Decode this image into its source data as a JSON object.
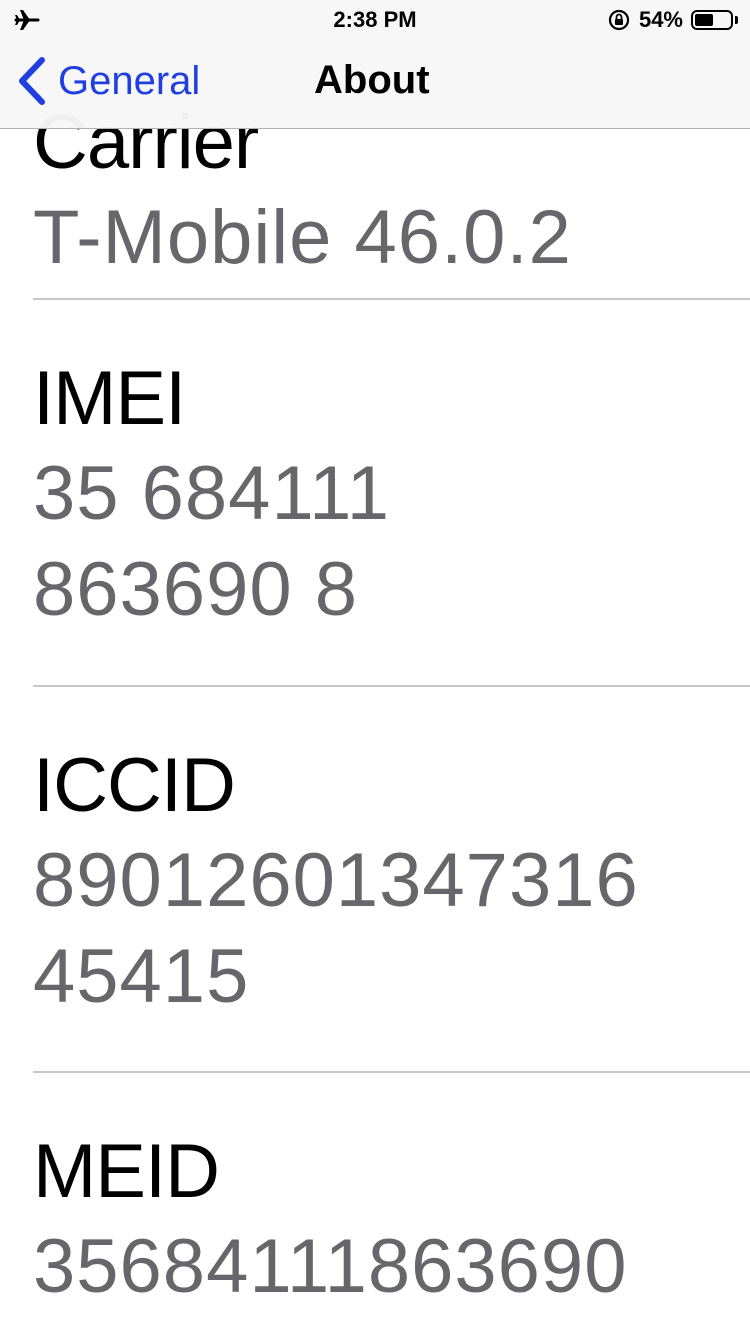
{
  "status_bar": {
    "time": "2:38 PM",
    "battery_percent_text": "54%",
    "battery_level": 0.54,
    "left_icon": "airplane-icon",
    "orientation_icon": "orientation-lock-icon"
  },
  "nav": {
    "back_label": "General",
    "title": "About",
    "accent_color": "#1f3fe0"
  },
  "cells": [
    {
      "label": "Carrier",
      "value": "T-Mobile 46.0.2"
    },
    {
      "label": "IMEI",
      "value_lines": [
        "35 684111",
        "863690 8"
      ]
    },
    {
      "label": "ICCID",
      "value_lines": [
        "89012601347316",
        "45415"
      ]
    },
    {
      "label": "MEID",
      "value": "35684111863690"
    }
  ]
}
